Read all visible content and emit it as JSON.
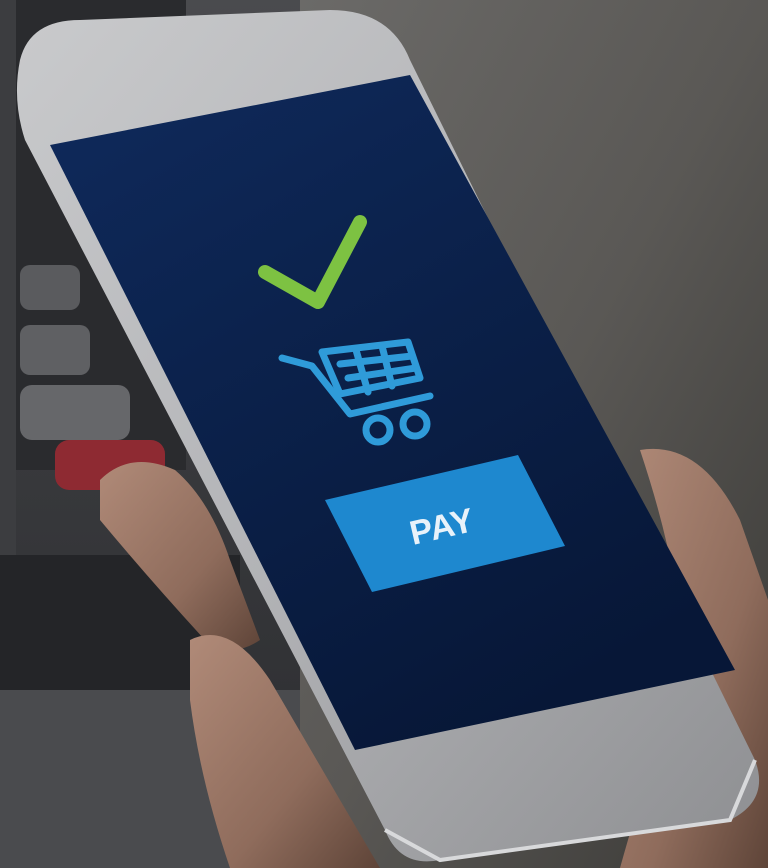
{
  "screen": {
    "pay_label": "PAY",
    "check_icon": "checkmark-icon",
    "cart_icon": "shopping-cart-icon"
  },
  "colors": {
    "screen_bg": "#0b1f4a",
    "check": "#7dc242",
    "cart": "#2f9bd9",
    "pay_button": "#1e88cf",
    "pay_text": "#e8f2fa"
  }
}
